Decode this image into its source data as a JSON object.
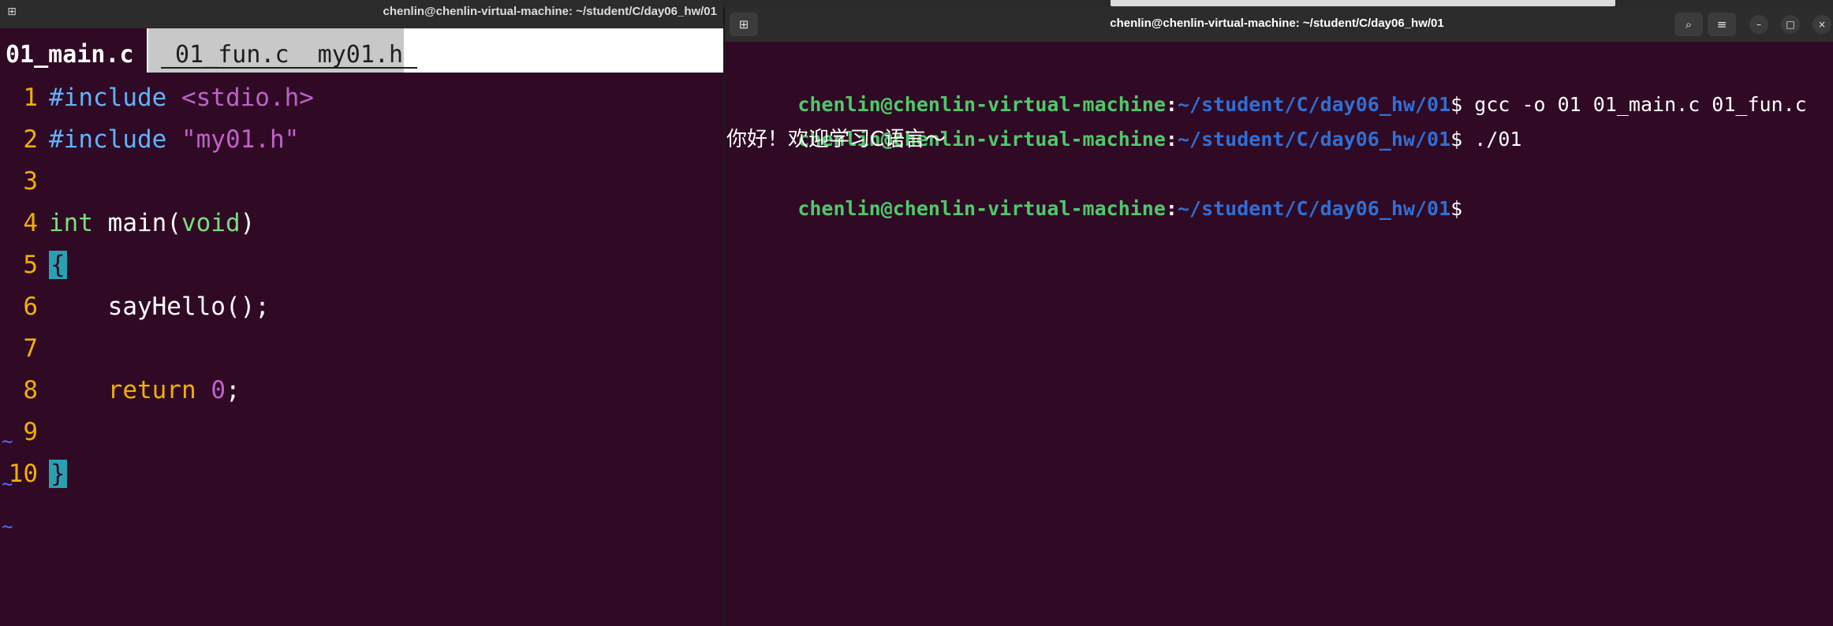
{
  "left_window": {
    "title": "chenlin@chenlin-virtual-machine: ~/student/C/day06_hw/01",
    "new_tab_icon": "new-tab-icon"
  },
  "vim": {
    "active_tab": "01_main.c",
    "inactive_tabs": " 01_fun.c  my01.h ",
    "lines": [
      {
        "num": "1",
        "parts": [
          {
            "cls": "kw-pre",
            "text": "#include"
          },
          {
            "cls": "",
            "text": " "
          },
          {
            "cls": "str",
            "text": "<stdio.h>"
          }
        ]
      },
      {
        "num": "2",
        "parts": [
          {
            "cls": "kw-pre",
            "text": "#include"
          },
          {
            "cls": "",
            "text": " "
          },
          {
            "cls": "str",
            "text": "\"my01.h\""
          }
        ]
      },
      {
        "num": "3",
        "parts": []
      },
      {
        "num": "4",
        "parts": [
          {
            "cls": "type",
            "text": "int"
          },
          {
            "cls": "",
            "text": " main("
          },
          {
            "cls": "type",
            "text": "void"
          },
          {
            "cls": "",
            "text": ")"
          }
        ]
      },
      {
        "num": "5",
        "parts": [
          {
            "cls": "brace",
            "text": "{"
          }
        ]
      },
      {
        "num": "6",
        "parts": [
          {
            "cls": "",
            "text": "    sayHello();"
          }
        ]
      },
      {
        "num": "7",
        "parts": []
      },
      {
        "num": "8",
        "parts": [
          {
            "cls": "",
            "text": "    "
          },
          {
            "cls": "ret",
            "text": "return"
          },
          {
            "cls": "",
            "text": " "
          },
          {
            "cls": "num",
            "text": "0"
          },
          {
            "cls": "",
            "text": ";"
          }
        ]
      },
      {
        "num": "9",
        "parts": []
      },
      {
        "num": "10",
        "parts": [
          {
            "cls": "brace",
            "text": "}"
          }
        ]
      }
    ],
    "empty_markers": [
      "~",
      "~",
      "~"
    ]
  },
  "right_window": {
    "title": "chenlin@chenlin-virtual-machine: ~/student/C/day06_hw/01",
    "buttons": {
      "search": "⌕",
      "menu": "≡",
      "minimize": "–",
      "maximize": "□",
      "close": "×"
    }
  },
  "terminal": {
    "prompt_user": "chenlin@chenlin-virtual-machine",
    "prompt_colon": ":",
    "prompt_path": "~/student/C/day06_hw/01",
    "prompt_symbol": "$",
    "commands": [
      " gcc -o 01 01_main.c 01_fun.c",
      " ./01",
      ""
    ],
    "output": "你好！欢迎学习C语言～"
  },
  "colors": {
    "background": "#300a24",
    "prompt_user": "#4ec96a",
    "prompt_path": "#2f6fd6",
    "line_numbers": "#f0b000"
  }
}
